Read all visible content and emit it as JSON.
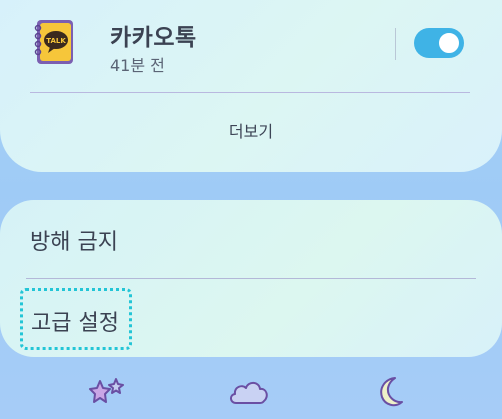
{
  "notification": {
    "app_name": "카카오톡",
    "time_ago": "41분 전",
    "app_icon_label": "TALK",
    "toggle_on": true,
    "more_label": "더보기"
  },
  "settings": {
    "do_not_disturb": "방해 금지",
    "advanced_settings": "고급 설정"
  },
  "bottom_nav": {
    "icons": [
      "stars-icon",
      "cloud-icon",
      "moon-icon"
    ]
  },
  "colors": {
    "accent": "#3fb3e6",
    "focus_outline": "#22c5d6"
  }
}
